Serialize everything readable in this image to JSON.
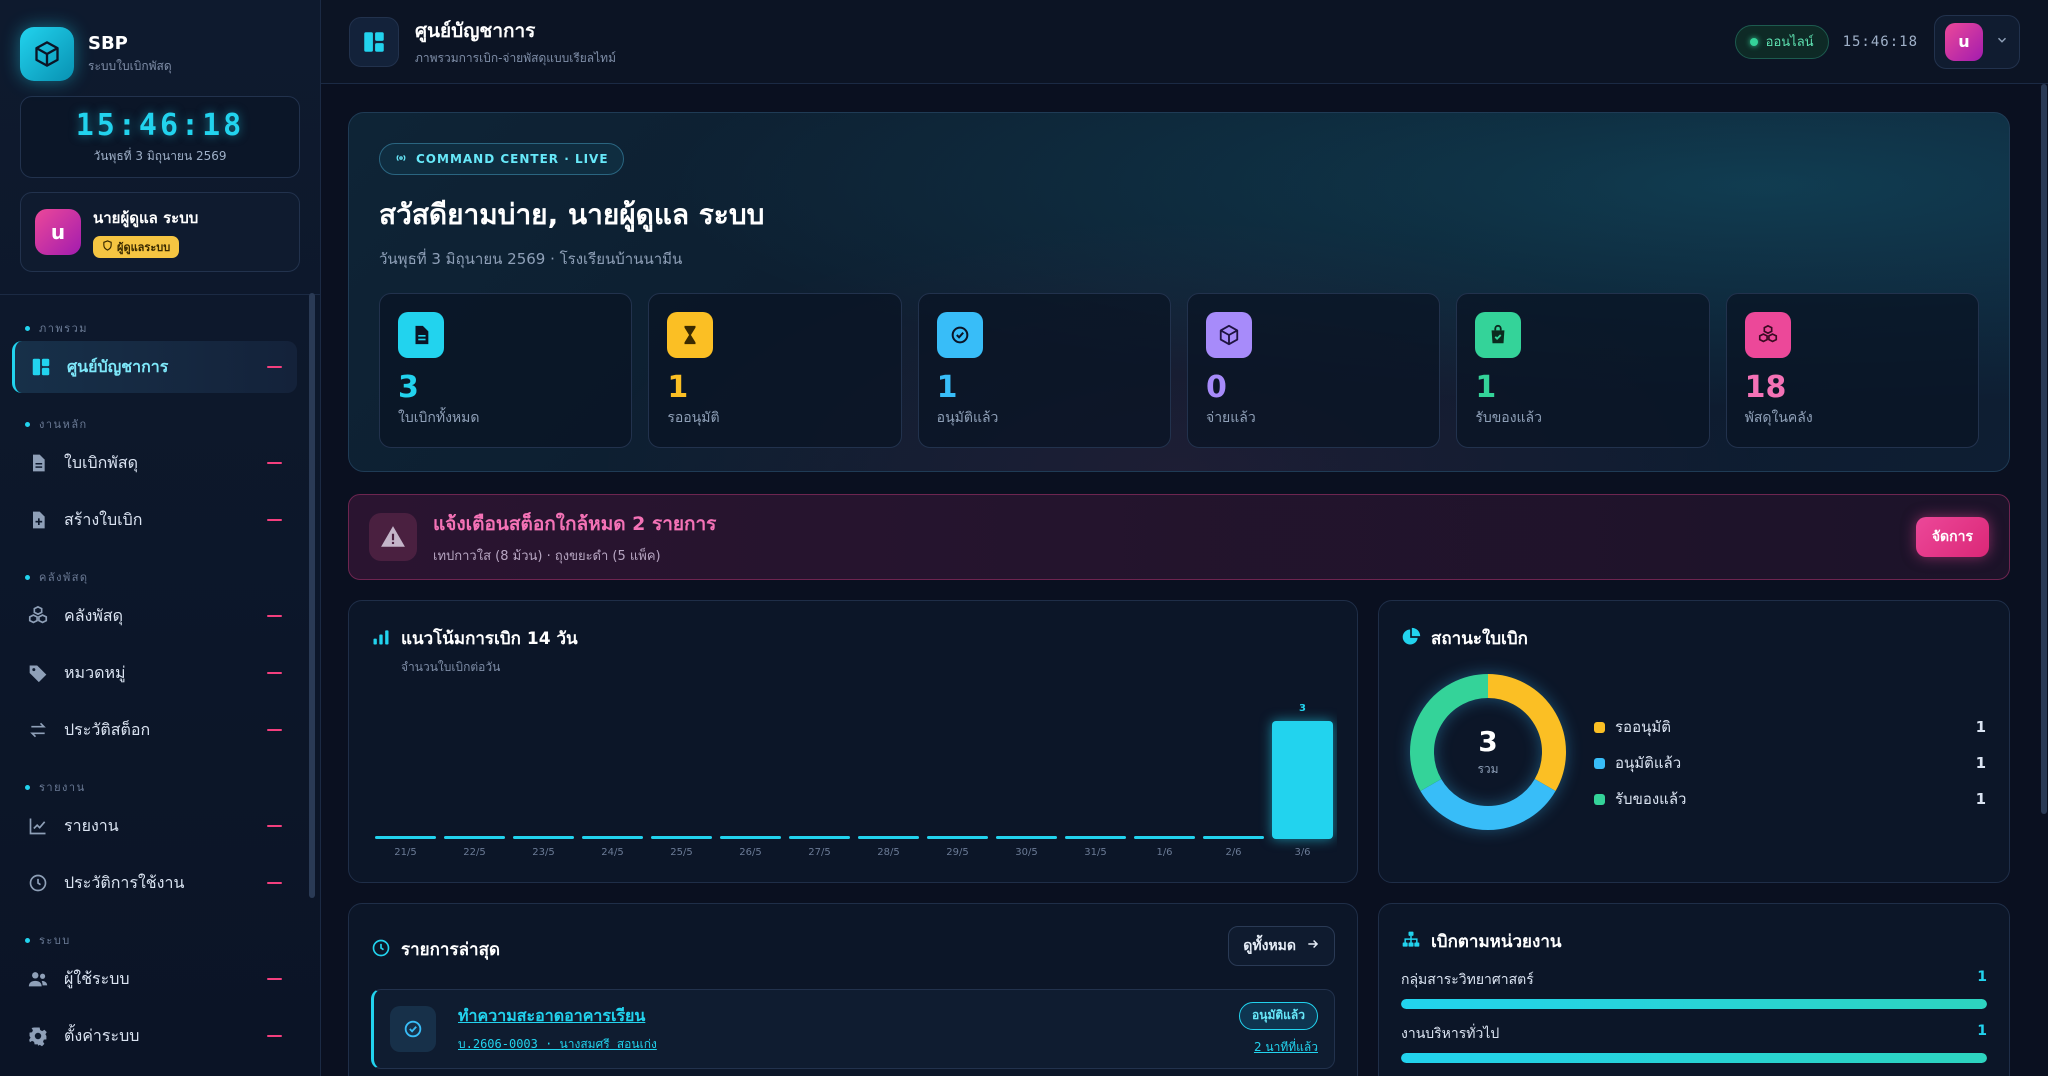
{
  "brand": {
    "name": "SBP",
    "subtitle": "ระบบใบเบิกพัสดุ"
  },
  "clock": {
    "time": "15:46:18",
    "date": "วันพุธที่ 3 มิถุนายน 2569"
  },
  "user": {
    "avatar_letter": "u",
    "name": "นายผู้ดูแล ระบบ",
    "role": "ผู้ดูแลระบบ"
  },
  "nav": {
    "sections": [
      {
        "title": "ภาพรวม",
        "items": [
          {
            "label": "ศูนย์บัญชาการ",
            "icon": "dashboard-icon",
            "active": true
          }
        ]
      },
      {
        "title": "งานหลัก",
        "items": [
          {
            "label": "ใบเบิกพัสดุ",
            "icon": "document-icon"
          },
          {
            "label": "สร้างใบเบิก",
            "icon": "document-plus-icon"
          }
        ]
      },
      {
        "title": "คลังพัสดุ",
        "items": [
          {
            "label": "คลังพัสดุ",
            "icon": "boxes-icon"
          },
          {
            "label": "หมวดหมู่",
            "icon": "tag-icon"
          },
          {
            "label": "ประวัติสต็อก",
            "icon": "swap-icon"
          }
        ]
      },
      {
        "title": "รายงาน",
        "items": [
          {
            "label": "รายงาน",
            "icon": "chart-line-icon"
          },
          {
            "label": "ประวัติการใช้งาน",
            "icon": "clock-icon"
          }
        ]
      },
      {
        "title": "ระบบ",
        "items": [
          {
            "label": "ผู้ใช้ระบบ",
            "icon": "users-icon"
          },
          {
            "label": "ตั้งค่าระบบ",
            "icon": "gear-icon"
          }
        ]
      }
    ]
  },
  "topbar": {
    "title": "ศูนย์บัญชาการ",
    "subtitle": "ภาพรวมการเบิก-จ่ายพัสดุแบบเรียลไทม์",
    "status": "ออนไลน์",
    "time": "15:46:18",
    "avatar_letter": "u"
  },
  "hero": {
    "badge": "COMMAND CENTER · LIVE",
    "greeting": "สวัสดียามบ่าย, นายผู้ดูแล ระบบ",
    "subtitle": "วันพุธที่ 3 มิถุนายน 2569 · โรงเรียนบ้านนามีน",
    "stats": [
      {
        "value": "3",
        "label": "ใบเบิกทั้งหมด",
        "color": "#22d3ee",
        "icon": "document-icon"
      },
      {
        "value": "1",
        "label": "รออนุมัติ",
        "color": "#fbbf24",
        "icon": "hourglass-icon"
      },
      {
        "value": "1",
        "label": "อนุมัติแล้ว",
        "color": "#38bdf8",
        "icon": "check-circle-icon"
      },
      {
        "value": "0",
        "label": "จ่ายแล้ว",
        "color": "#a78bfa",
        "icon": "box-icon"
      },
      {
        "value": "1",
        "label": "รับของแล้ว",
        "color": "#34d399",
        "icon": "bag-check-icon"
      },
      {
        "value": "18",
        "label": "พัสดุในคลัง",
        "color": "#f472b6",
        "icon": "boxes-icon"
      }
    ]
  },
  "alert": {
    "title": "แจ้งเตือนสต็อกใกล้หมด 2 รายการ",
    "detail": "เทปกาวใส (8 ม้วน) · ถุงขยะดำ (5 แพ็ค)",
    "button": "จัดการ"
  },
  "trend": {
    "title": "แนวโน้มการเบิก 14 วัน",
    "subtitle": "จำนวนใบเบิกต่อวัน"
  },
  "chart_data": [
    {
      "type": "bar",
      "title": "แนวโน้มการเบิก 14 วัน",
      "ylabel": "จำนวนใบเบิกต่อวัน",
      "categories": [
        "21/5",
        "22/5",
        "23/5",
        "24/5",
        "25/5",
        "26/5",
        "27/5",
        "28/5",
        "29/5",
        "30/5",
        "31/5",
        "1/6",
        "2/6",
        "3/6"
      ],
      "values": [
        0,
        0,
        0,
        0,
        0,
        0,
        0,
        0,
        0,
        0,
        0,
        0,
        0,
        3
      ],
      "data_labels": [
        "",
        "",
        "",
        "",
        "",
        "",
        "",
        "",
        "",
        "",
        "",
        "",
        "",
        "3"
      ],
      "color": "#22d3ee",
      "grid": false
    },
    {
      "type": "pie",
      "title": "สถานะใบเบิก",
      "categories": [
        "รออนุมัติ",
        "อนุมัติแล้ว",
        "รับของแล้ว"
      ],
      "values": [
        1,
        1,
        1
      ],
      "colors": [
        "#fbbf24",
        "#38bdf8",
        "#34d399"
      ],
      "total": "3",
      "total_label": "รวม"
    }
  ],
  "status_panel": {
    "title": "สถานะใบเบิก"
  },
  "recent": {
    "title": "รายการล่าสุด",
    "view_all": "ดูทั้งหมด",
    "items": [
      {
        "title": "ทำความสะอาดอาคารเรียน",
        "meta": "บ.2606-0003 · นางสมศรี สอนเก่ง",
        "status": "อนุมัติแล้ว",
        "time": "2 นาทีที่แล้ว"
      }
    ]
  },
  "dept": {
    "title": "เบิกตามหน่วยงาน",
    "rows": [
      {
        "name": "กลุ่มสาระวิทยาศาสตร์",
        "count": "1",
        "share": 1
      },
      {
        "name": "งานบริหารทั่วไป",
        "count": "1",
        "share": 1
      }
    ]
  }
}
